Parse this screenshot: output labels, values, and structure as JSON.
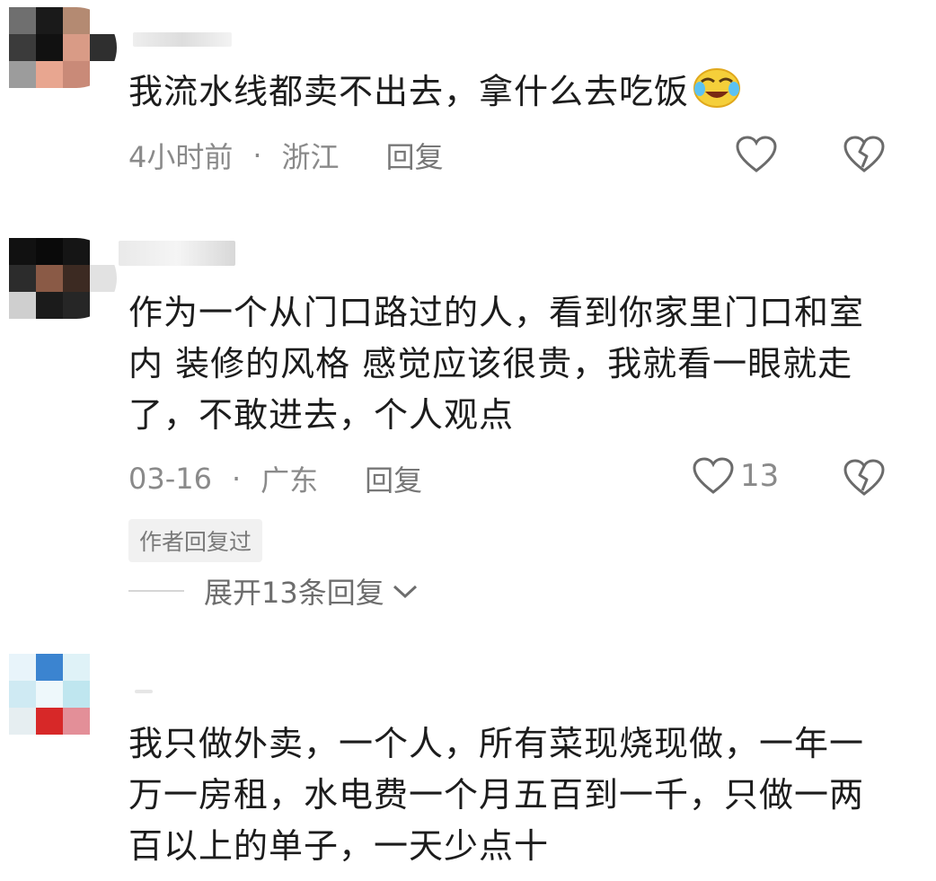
{
  "comments": [
    {
      "text": "我流水线都卖不出去，拿什么去吃饭",
      "emoji": "crying-laughing-emoji",
      "time": "4小时前",
      "location": "浙江",
      "reply": "回复",
      "likes": ""
    },
    {
      "text": "作为一个从门口路过的人，看到你家里门口和室内 装修的风格 感觉应该很贵，我就看一眼就走了，不敢进去，个人观点",
      "time": "03-16",
      "location": "广东",
      "reply": "回复",
      "likes": "13",
      "author_tag": "作者回复过",
      "expand": "展开13条回复"
    },
    {
      "text": "我只做外卖，一个人，所有菜现烧现做，一年一万一房租，水电费一个月五百到一千，只做一两百以上的单子，一天少点十"
    }
  ],
  "separator": "·",
  "colors": {
    "text": "#1c1c1c",
    "meta": "#8a8a8a",
    "tag_bg": "#f1f1f1",
    "icon": "#6b6b6b"
  },
  "icons": [
    "heart-outline-icon",
    "broken-heart-icon",
    "chevron-down-icon"
  ]
}
